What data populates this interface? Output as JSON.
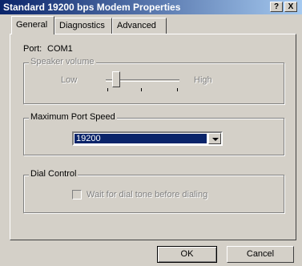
{
  "window": {
    "title": "Standard 19200 bps Modem Properties",
    "help_label": "?",
    "close_label": "X"
  },
  "tabs": [
    {
      "label": "General",
      "active": true
    },
    {
      "label": "Diagnostics",
      "active": false
    },
    {
      "label": "Advanced",
      "active": false
    }
  ],
  "general": {
    "port_label": "Port:",
    "port_value": "COM1",
    "speaker": {
      "label": "Speaker volume",
      "low_label": "Low",
      "high_label": "High",
      "level": 0.1
    },
    "port_speed": {
      "label": "Maximum Port Speed",
      "selected": "19200"
    },
    "dial_control": {
      "label": "Dial Control",
      "checkbox_label": "Wait for dial tone before dialing",
      "checked": false
    }
  },
  "buttons": {
    "ok_label": "OK",
    "cancel_label": "Cancel"
  }
}
